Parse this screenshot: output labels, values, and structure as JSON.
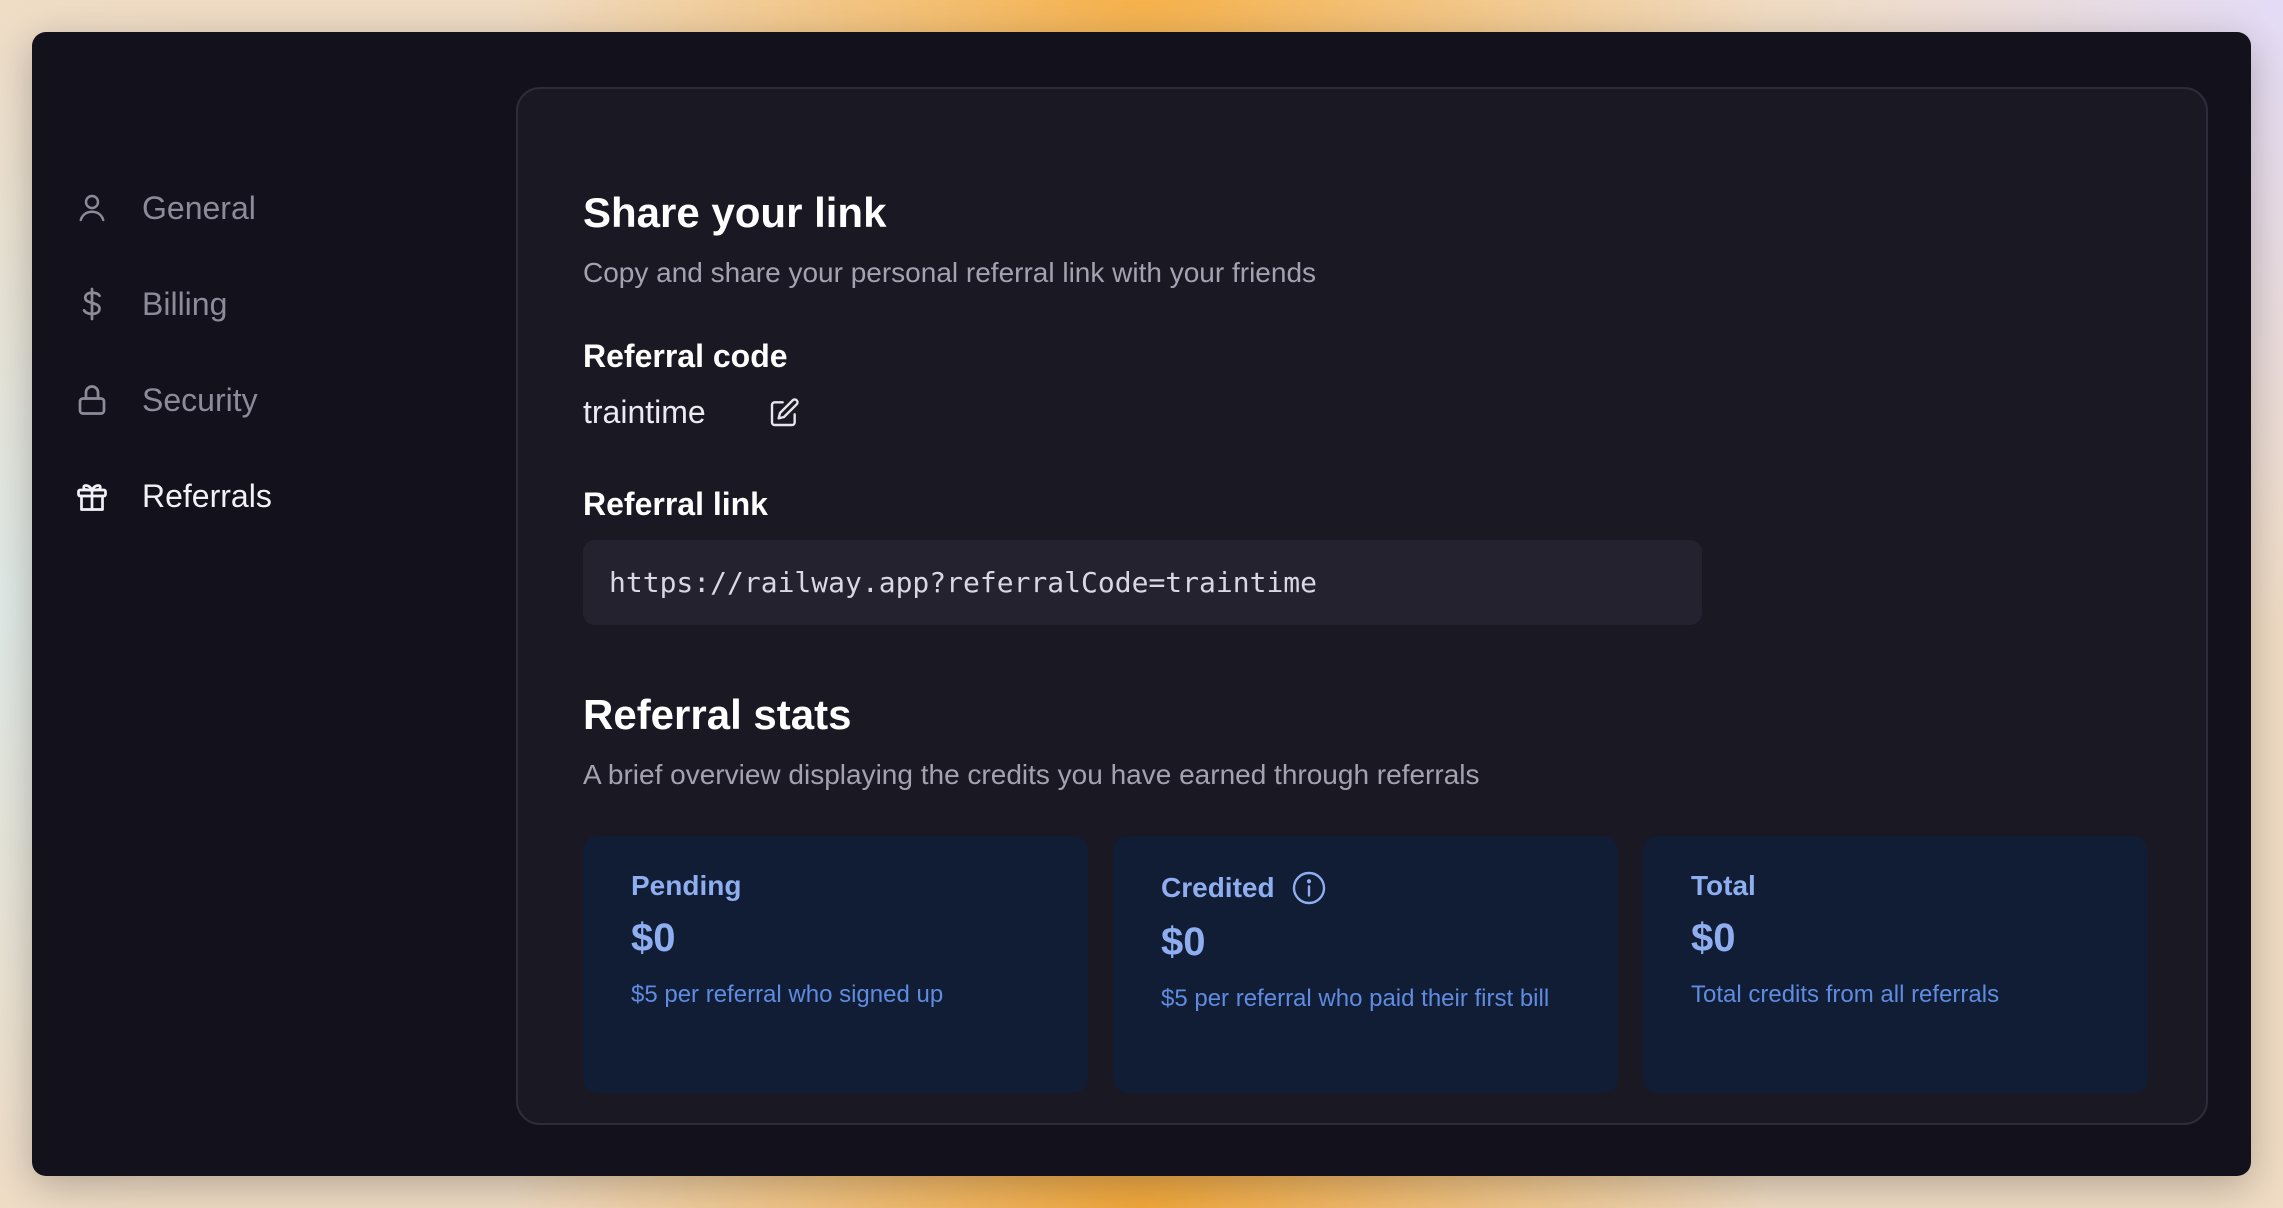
{
  "sidebar": {
    "items": [
      {
        "label": "General",
        "icon": "user-icon"
      },
      {
        "label": "Billing",
        "icon": "dollar-icon"
      },
      {
        "label": "Security",
        "icon": "lock-icon"
      },
      {
        "label": "Referrals",
        "icon": "gift-icon",
        "active": true
      }
    ]
  },
  "share": {
    "title": "Share your link",
    "description": "Copy and share your personal referral link with your friends",
    "code_label": "Referral code",
    "code_value": "traintime",
    "link_label": "Referral link",
    "link_value": "https://railway.app?referralCode=traintime"
  },
  "stats": {
    "title": "Referral stats",
    "description": "A brief overview displaying the credits you have earned through referrals",
    "cards": [
      {
        "title": "Pending",
        "value": "$0",
        "note": "$5 per referral who signed up"
      },
      {
        "title": "Credited",
        "value": "$0",
        "note": "$5 per referral who paid their first bill",
        "has_info": true
      },
      {
        "title": "Total",
        "value": "$0",
        "note": "Total credits from all referrals"
      }
    ]
  },
  "colors": {
    "window_bg": "#13121c",
    "panel_bg": "#191823",
    "card_bg": "#111c35",
    "card_accent": "#8eaef0",
    "card_note": "#5f8ce0"
  }
}
